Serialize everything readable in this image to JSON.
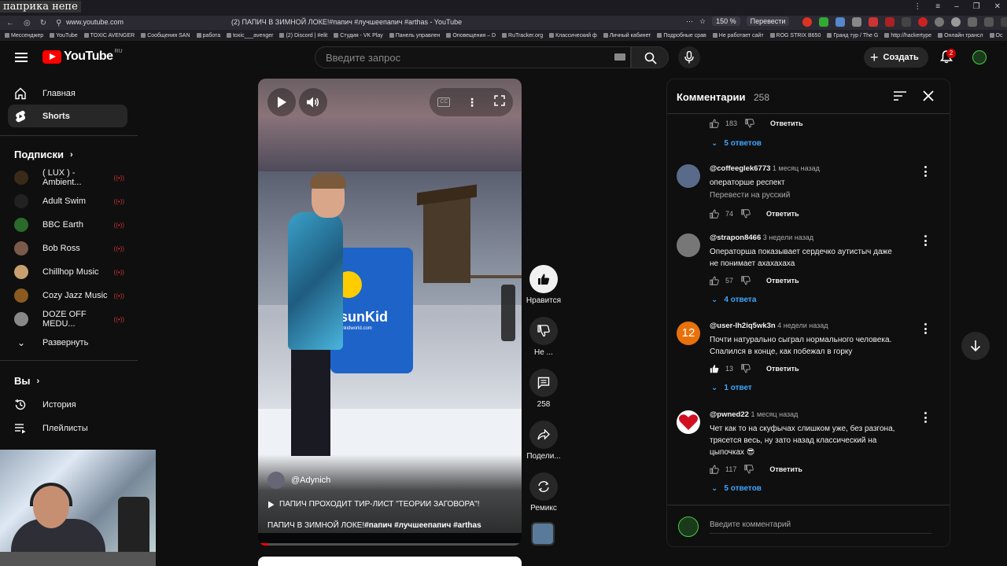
{
  "browser": {
    "tab_title": "паприка непе",
    "url": "www.youtube.com",
    "page_title": "(2) ПАПИЧ В ЗИМНОЙ ЛОКЕ!#папич #лучшеепапич #arthas - YouTube",
    "zoom": "150 %",
    "translate": "Перевести",
    "bookmarks": [
      "Мессенджер",
      "YouTube",
      "TOXIC AVENGER",
      "Сообщения SAN",
      "работа",
      "toxic___avenger",
      "(2) Discord | #elit",
      "Студия - VK Play",
      "Панель управлен",
      "Оповещения – D",
      "RuTracker.org",
      "Классический ф",
      "Личный кабинет",
      "Подробные срав",
      "Не работает сайт",
      "ROG STRIX B650",
      "Гранд тур / The G",
      "http://hackertype",
      "Онлайн трансл",
      "Ос"
    ]
  },
  "header": {
    "logo_text": "YouTube",
    "logo_region": "RU",
    "search_placeholder": "Введите запрос",
    "create_label": "Создать",
    "notifications_count": "2"
  },
  "sidebar": {
    "main": [
      {
        "label": "Главная",
        "icon": "home-icon"
      },
      {
        "label": "Shorts",
        "icon": "shorts-icon"
      }
    ],
    "subscriptions_title": "Подписки",
    "subscriptions": [
      {
        "label": "( LUX ) - Ambient...",
        "color": "#3a2a18"
      },
      {
        "label": "Adult Swim",
        "color": "#222222"
      },
      {
        "label": "BBC Earth",
        "color": "#2a6a2a"
      },
      {
        "label": "Bob Ross",
        "color": "#7a5a4a"
      },
      {
        "label": "Chillhop Music",
        "color": "#c8a070"
      },
      {
        "label": "Cozy Jazz Music",
        "color": "#8a5a20"
      },
      {
        "label": "DOZE OFF MEDU...",
        "color": "#888888"
      }
    ],
    "expand_label": "Развернуть",
    "you_title": "Вы",
    "you_items": [
      {
        "label": "История",
        "icon": "history-icon"
      },
      {
        "label": "Плейлисты",
        "icon": "playlists-icon"
      }
    ]
  },
  "player": {
    "channel": "@Adynich",
    "playlist": "ПАПИЧ ПРОХОДИТ ТИР-ЛИСТ \"ТЕОРИИ ЗАГОВОРА\"!",
    "title_prefix": "ПАПИЧ В ЗИМНОЙ ЛОКЕ!",
    "hashtags": "#папич #лучшеепапич #arthas",
    "sign_brand": "sunKid",
    "sign_site": "sunkidworld.com",
    "progress": 0.04
  },
  "actions": {
    "like": "Нравится",
    "dislike": "Не ...",
    "comments": "258",
    "share": "Подели...",
    "remix": "Ремикс"
  },
  "comments": {
    "title": "Комментарии",
    "count": "258",
    "top_stub": {
      "likes": "183",
      "reply": "Ответить",
      "replies": "5 ответов"
    },
    "items": [
      {
        "author": "@coffeeglek6773",
        "time": "1 месяц назад",
        "lines": [
          "операторше респект"
        ],
        "translate": "Перевести на русский",
        "likes": "74",
        "reply": "Ответить",
        "replies": "",
        "avatar_color": "#5a6a8a"
      },
      {
        "author": "@strapon8466",
        "time": "3 недели назад",
        "lines": [
          "Операторша показывает сердечко аутистыч даже",
          "не понимает ахахахаха"
        ],
        "translate": "",
        "likes": "57",
        "reply": "Ответить",
        "replies": "4 ответа",
        "avatar_color": "#777777"
      },
      {
        "author": "@user-lh2iq5wk3n",
        "time": "4 недели назад",
        "lines": [
          "Почти натурально сыграл нормального человека.",
          "Спалился в конце, как побежал в горку"
        ],
        "translate": "",
        "likes": "13",
        "reply": "Ответить",
        "replies": "1 ответ",
        "avatar_color": "#e8710a",
        "avatar_text": "12"
      },
      {
        "author": "@pwned22",
        "time": "1 месяц назад",
        "lines": [
          "Чет как то на скуфычах слишком уже, без разгона,",
          "трясется весь, ну зато назад классический на",
          "цыпочках 😎"
        ],
        "translate": "",
        "likes": "117",
        "reply": "Ответить",
        "replies": "5 ответов",
        "avatar_color": "#ffffff"
      }
    ],
    "input_placeholder": "Введите комментарий"
  }
}
